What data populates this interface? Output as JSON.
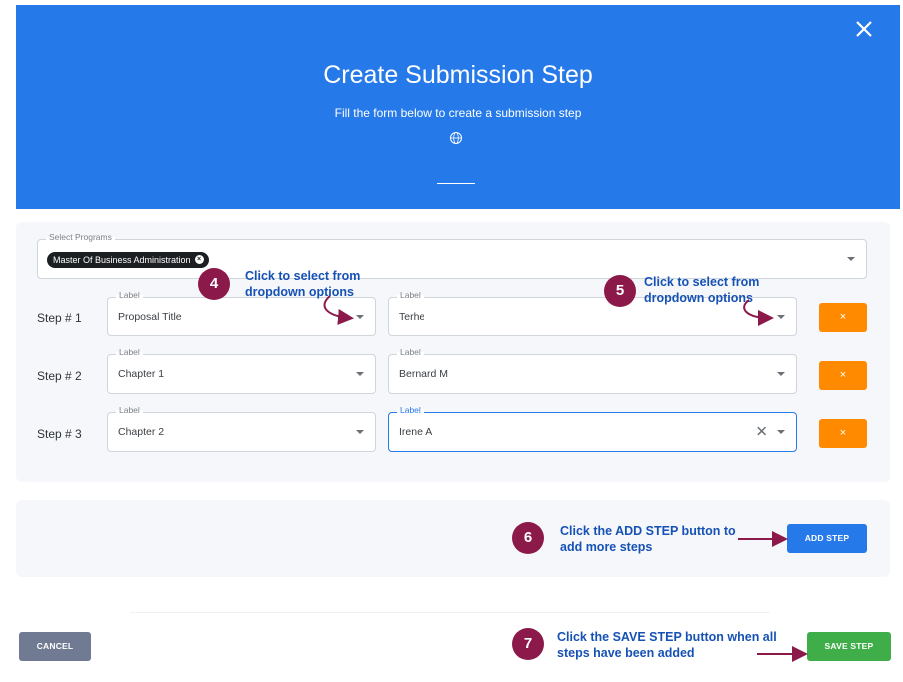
{
  "modal": {
    "title": "Create Submission Step",
    "subtitle": "Fill the form below to create a submission step",
    "close_icon": "close-icon",
    "globe_icon": "globe-icon"
  },
  "programs": {
    "label": "Select Programs",
    "selected_chip": "Master Of Business Administration"
  },
  "steps": [
    {
      "step_label": "Step # 1",
      "left_label": "Label",
      "left_value": "Proposal Title",
      "right_label": "Label",
      "right_value": "Terhe",
      "remove": "×"
    },
    {
      "step_label": "Step # 2",
      "left_label": "Label",
      "left_value": "Chapter 1",
      "right_label": "Label",
      "right_value": "Bernard M",
      "remove": "×"
    },
    {
      "step_label": "Step # 3",
      "left_label": "Label",
      "left_value": "Chapter 2",
      "right_label": "Label",
      "right_value": "Irene A",
      "remove": "×"
    }
  ],
  "buttons": {
    "add_step": "ADD STEP",
    "cancel": "CANCEL",
    "save_step": "SAVE STEP"
  },
  "annotations": [
    {
      "number": "4",
      "text_line1": "Click to select from",
      "text_line2": "dropdown options"
    },
    {
      "number": "5",
      "text_line1": "Click to select from",
      "text_line2": "dropdown options"
    },
    {
      "number": "6",
      "text_line1": "Click the ADD STEP button to",
      "text_line2": "add more steps"
    },
    {
      "number": "7",
      "text_line1": "Click the SAVE STEP button when all",
      "text_line2": "steps have been added"
    }
  ],
  "colors": {
    "header_blue": "#2679e8",
    "remove_orange": "#ff8a00",
    "save_green": "#3fae49",
    "cancel_gray": "#717a93",
    "annotation_maroon": "#8b1a4a",
    "annotation_text_blue": "#1652b5"
  }
}
